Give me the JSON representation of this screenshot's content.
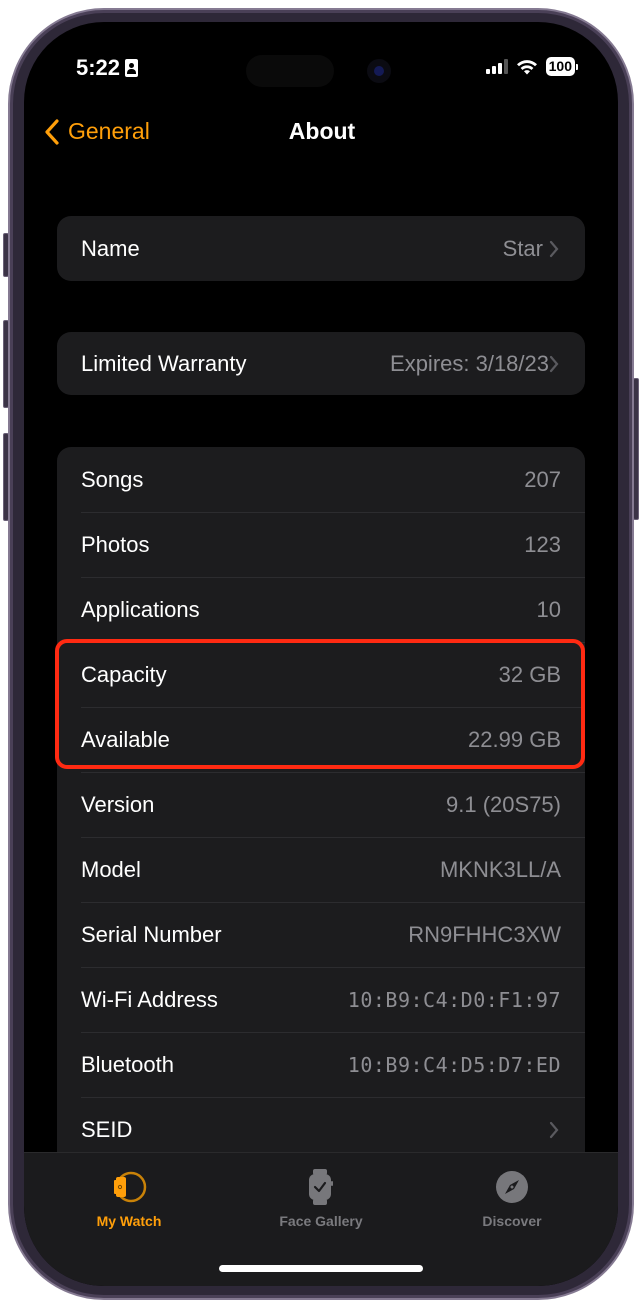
{
  "status_bar": {
    "time": "5:22",
    "battery": "100",
    "icons": [
      "contact-card-icon",
      "cellular-signal-icon",
      "wifi-icon",
      "battery-icon"
    ]
  },
  "nav": {
    "back_label": "General",
    "title": "About"
  },
  "name_group": {
    "label": "Name",
    "value": "Star"
  },
  "warranty_group": {
    "label": "Limited Warranty",
    "value": "Expires: 3/18/23"
  },
  "info_group": {
    "rows": [
      {
        "label": "Songs",
        "value": "207"
      },
      {
        "label": "Photos",
        "value": "123"
      },
      {
        "label": "Applications",
        "value": "10"
      },
      {
        "label": "Capacity",
        "value": "32 GB"
      },
      {
        "label": "Available",
        "value": "22.99 GB"
      },
      {
        "label": "Version",
        "value": "9.1 (20S75)"
      },
      {
        "label": "Model",
        "value": "MKNK3LL/A"
      },
      {
        "label": "Serial Number",
        "value": "RN9FHHC3XW"
      },
      {
        "label": "Wi-Fi Address",
        "value": "10:B9:C4:D0:F1:97"
      },
      {
        "label": "Bluetooth",
        "value": "10:B9:C4:D5:D7:ED"
      },
      {
        "label": "SEID",
        "value": ""
      }
    ]
  },
  "highlight": {
    "color": "#ff2a12",
    "rows": [
      "Capacity",
      "Available"
    ]
  },
  "tab_bar": {
    "tabs": [
      {
        "label": "My Watch",
        "icon": "my-watch-icon",
        "active": true
      },
      {
        "label": "Face Gallery",
        "icon": "face-gallery-icon",
        "active": false
      },
      {
        "label": "Discover",
        "icon": "compass-icon",
        "active": false
      }
    ]
  },
  "colors": {
    "accent": "#ff9f0a",
    "background": "#000000",
    "cell": "#1c1c1e",
    "secondary_text": "#8e8e93"
  }
}
